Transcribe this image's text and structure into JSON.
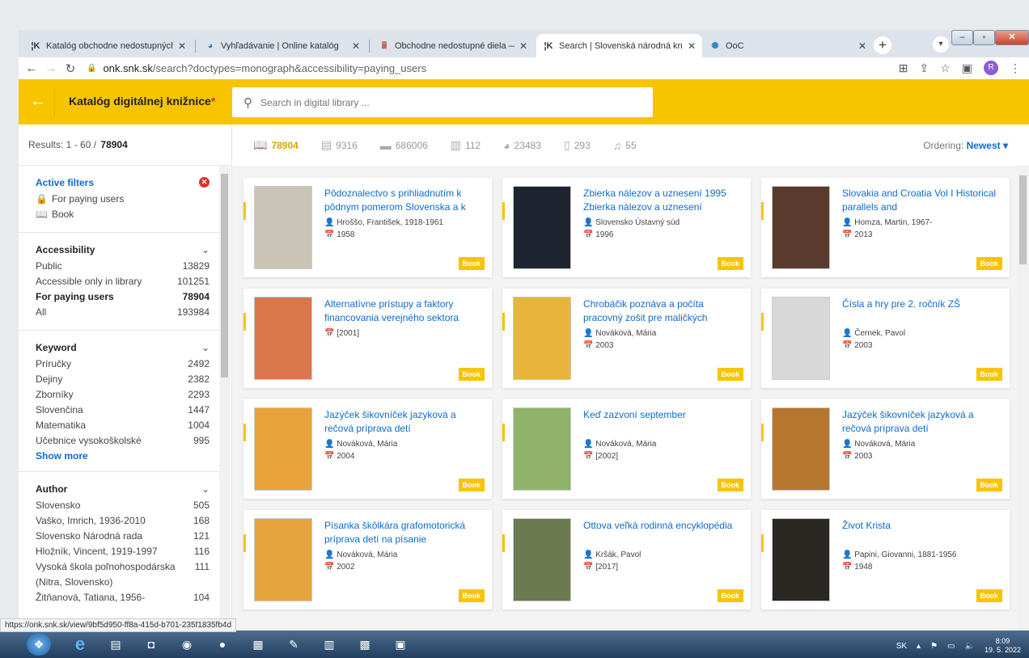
{
  "browser": {
    "tabs": [
      {
        "label": "Katalóg obchodne nedostupných",
        "active": false
      },
      {
        "label": "Vyhľadávanie | Online katalóg",
        "active": false
      },
      {
        "label": "Obchodne nedostupné diela — |",
        "active": false
      },
      {
        "label": "Search | Slovenská národná kniž",
        "active": true
      },
      {
        "label": "OoC",
        "active": false
      }
    ],
    "url_host": "onk.snk.sk",
    "url_path": "/search?doctypes=monograph&accessibility=paying_users",
    "profile_initial": "R"
  },
  "app": {
    "title": "Katalóg digitálnej knižnice",
    "search_placeholder": "Search in digital library ..."
  },
  "results": {
    "label": "Results: 1 - 60 /",
    "total": "78904"
  },
  "doctypes": [
    {
      "icon": "book-icon",
      "count": "78904",
      "active": true
    },
    {
      "icon": "newspaper-icon",
      "count": "9316",
      "active": false
    },
    {
      "icon": "document-icon",
      "count": "686006",
      "active": false
    },
    {
      "icon": "map-icon",
      "count": "112",
      "active": false
    },
    {
      "icon": "palette-icon",
      "count": "23483",
      "active": false
    },
    {
      "icon": "manuscript-icon",
      "count": "293",
      "active": false
    },
    {
      "icon": "music-icon",
      "count": "55",
      "active": false
    }
  ],
  "ordering": {
    "label": "Ordering:",
    "value": "Newest"
  },
  "active_filters": {
    "title": "Active filters",
    "items": [
      "For paying users",
      "Book"
    ]
  },
  "filters": [
    {
      "title": "Accessibility",
      "rows": [
        {
          "label": "Public",
          "count": "13829"
        },
        {
          "label": "Accessible only in library",
          "count": "101251"
        },
        {
          "label": "For paying users",
          "count": "78904",
          "selected": true
        },
        {
          "label": "All",
          "count": "193984"
        }
      ]
    },
    {
      "title": "Keyword",
      "rows": [
        {
          "label": "Príručky",
          "count": "2492"
        },
        {
          "label": "Dejiny",
          "count": "2382"
        },
        {
          "label": "Zborníky",
          "count": "2293"
        },
        {
          "label": "Slovenčina",
          "count": "1447"
        },
        {
          "label": "Matematika",
          "count": "1004"
        },
        {
          "label": "Učebnice vysokoškolské",
          "count": "995"
        }
      ],
      "show_more": "Show more"
    },
    {
      "title": "Author",
      "rows": [
        {
          "label": "Slovensko",
          "count": "505"
        },
        {
          "label": "Vaško, Imrich, 1936-2010",
          "count": "168"
        },
        {
          "label": "Slovensko Národná rada",
          "count": "121"
        },
        {
          "label": "Hložník, Vincent, 1919-1997",
          "count": "116"
        },
        {
          "label": "Vysoká škola poľnohospodárska",
          "count": "111"
        },
        {
          "label": "(Nitra, Slovensko)",
          "count": ""
        },
        {
          "label": "Žitňanová, Tatiana, 1956-",
          "count": "104"
        }
      ]
    }
  ],
  "books": [
    {
      "title": "Pôdoznalectvo s prihliadnutím k pôdnym pomerom Slovenska a k",
      "author": "Hroššo, František, 1918-1961",
      "year": "1958",
      "badge": "Book",
      "thumb": "#c9c4b5"
    },
    {
      "title": "Zbierka nálezov a uznesení 1995 Zbierka nálezov a uznesení",
      "author": "Slovensko Ústavný súd",
      "year": "1996",
      "badge": "Book",
      "thumb": "#1e2430"
    },
    {
      "title": "Slovakia and Croatia Vol I Historical parallels and",
      "author": "Homza, Martin, 1967-",
      "year": "2013",
      "badge": "Book",
      "thumb": "#5a3a2c"
    },
    {
      "title": "Alternatívne prístupy a faktory financovania verejného sektora",
      "author": "",
      "year": "[2001]",
      "badge": "Book",
      "thumb": "#d9774a"
    },
    {
      "title": "Chrobáčik poznáva a počíta pracovný zošit pre maličkých",
      "author": "Nováková, Mária",
      "year": "2003",
      "badge": "Book",
      "thumb": "#e8b43a"
    },
    {
      "title": "Čísla a hry pre 2. ročník ZŠ",
      "author": "Černek, Pavol",
      "year": "2003",
      "badge": "Book",
      "thumb": "#d8d8d8"
    },
    {
      "title": "Jazýček šikovníček jazyková a rečová príprava detí",
      "author": "Nováková, Mária",
      "year": "2004",
      "badge": "Book",
      "thumb": "#e9a23a"
    },
    {
      "title": "Keď zazvoní september",
      "author": "Nováková, Mária",
      "year": "[2002]",
      "badge": "Book",
      "thumb": "#8fb36b"
    },
    {
      "title": "Jazýček šikovníček jazyková a rečová príprava detí",
      "author": "Nováková, Mária",
      "year": "2003",
      "badge": "Book",
      "thumb": "#b5762f"
    },
    {
      "title": "Písanka škôlkára grafomotorická príprava detí na písanie",
      "author": "Nováková, Mária",
      "year": "2002",
      "badge": "Book",
      "thumb": "#e7a33e"
    },
    {
      "title": "Ottova veľká rodinná encyklopédia",
      "author": "Kršák, Pavol",
      "year": "[2017]",
      "badge": "Book",
      "thumb": "#6c7a52"
    },
    {
      "title": "Život Krista",
      "author": "Papini, Giovanni, 1881-1956",
      "year": "1948",
      "badge": "Book",
      "thumb": "#2a2622"
    }
  ],
  "status_url": "https://onk.snk.sk/view/9bf5d950-ff8a-415d-b701-235f1835fb4d",
  "taskbar": {
    "lang": "SK",
    "time": "8:09",
    "date": "19. 5. 2022"
  }
}
